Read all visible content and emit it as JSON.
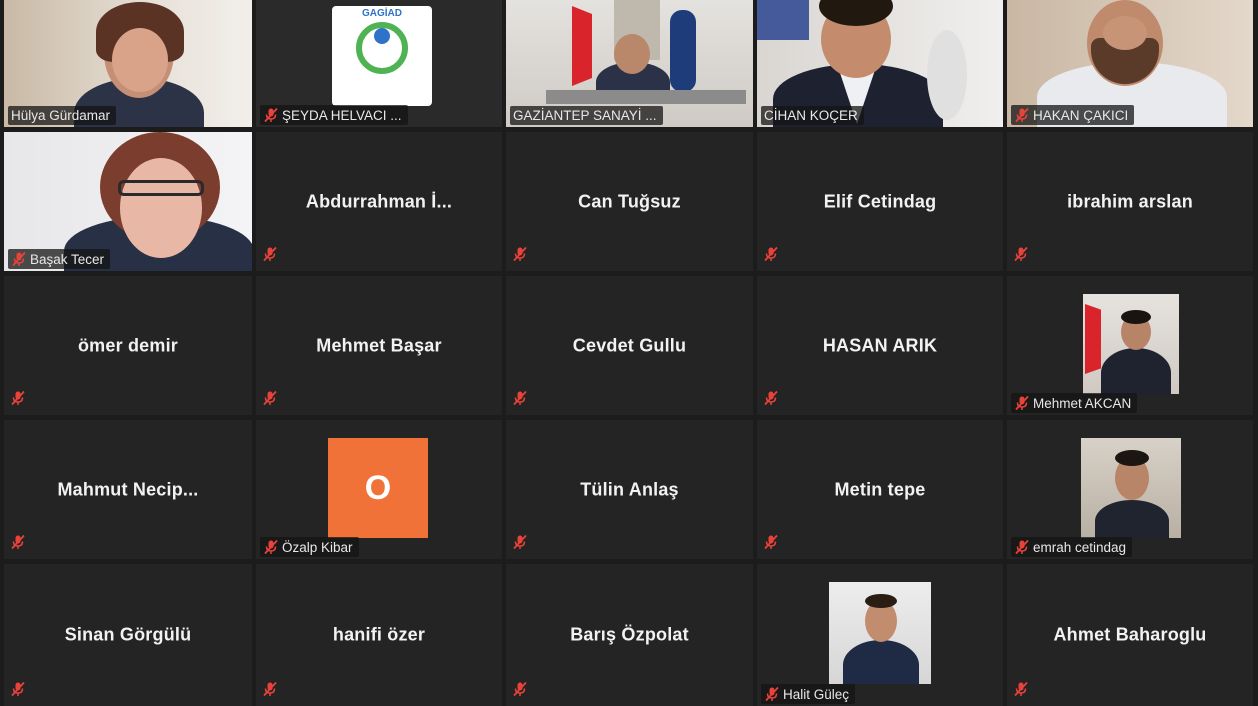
{
  "participants": [
    {
      "name": "Hülya Gürdamar",
      "type": "video",
      "muted": false
    },
    {
      "name": "ŞEYDA HELVACI ...",
      "type": "video",
      "muted": true,
      "logo_text": "GAGİAD"
    },
    {
      "name": "GAZİANTEP SANAYİ ...",
      "type": "video",
      "muted": false
    },
    {
      "name": "CİHAN KOÇER",
      "type": "video",
      "muted": false,
      "active_speaker": true
    },
    {
      "name": "HAKAN ÇAKICI",
      "type": "video",
      "muted": true
    },
    {
      "name": "Başak Tecer",
      "type": "video",
      "muted": true
    },
    {
      "name": "Abdurrahman  İ...",
      "type": "name",
      "muted": true
    },
    {
      "name": "Can Tuğsuz",
      "type": "name",
      "muted": true
    },
    {
      "name": "Elif Cetindag",
      "type": "name",
      "muted": true
    },
    {
      "name": "ibrahim arslan",
      "type": "name",
      "muted": true
    },
    {
      "name": "ömer demir",
      "type": "name",
      "muted": true
    },
    {
      "name": "Mehmet Başar",
      "type": "name",
      "muted": true
    },
    {
      "name": "Cevdet Gullu",
      "type": "name",
      "muted": true
    },
    {
      "name": "HASAN ARIK",
      "type": "name",
      "muted": true
    },
    {
      "name": "Mehmet AKCAN",
      "type": "photo",
      "muted": true
    },
    {
      "name": "Mahmut  Necip...",
      "type": "name",
      "muted": true
    },
    {
      "name": "Özalp Kibar",
      "type": "avatar",
      "muted": true,
      "avatar_letter": "O"
    },
    {
      "name": "Tülin Anlaş",
      "type": "name",
      "muted": true
    },
    {
      "name": "Metin tepe",
      "type": "name",
      "muted": true
    },
    {
      "name": "emrah cetindag",
      "type": "photo",
      "muted": true
    },
    {
      "name": "Sinan Görgülü",
      "type": "name",
      "muted": true
    },
    {
      "name": "hanifi özer",
      "type": "name",
      "muted": true
    },
    {
      "name": "Barış Özpolat",
      "type": "name",
      "muted": true
    },
    {
      "name": "Halit Güleç",
      "type": "photo",
      "muted": true
    },
    {
      "name": "Ahmet Baharoglu",
      "type": "name",
      "muted": true
    }
  ],
  "colors": {
    "background": "#1c1c1c",
    "tile": "#242424",
    "active_border": "#b6d33a",
    "muted_icon": "#e8423a",
    "avatar": "#f07238"
  },
  "icons": {
    "muted": "microphone-muted-icon"
  }
}
